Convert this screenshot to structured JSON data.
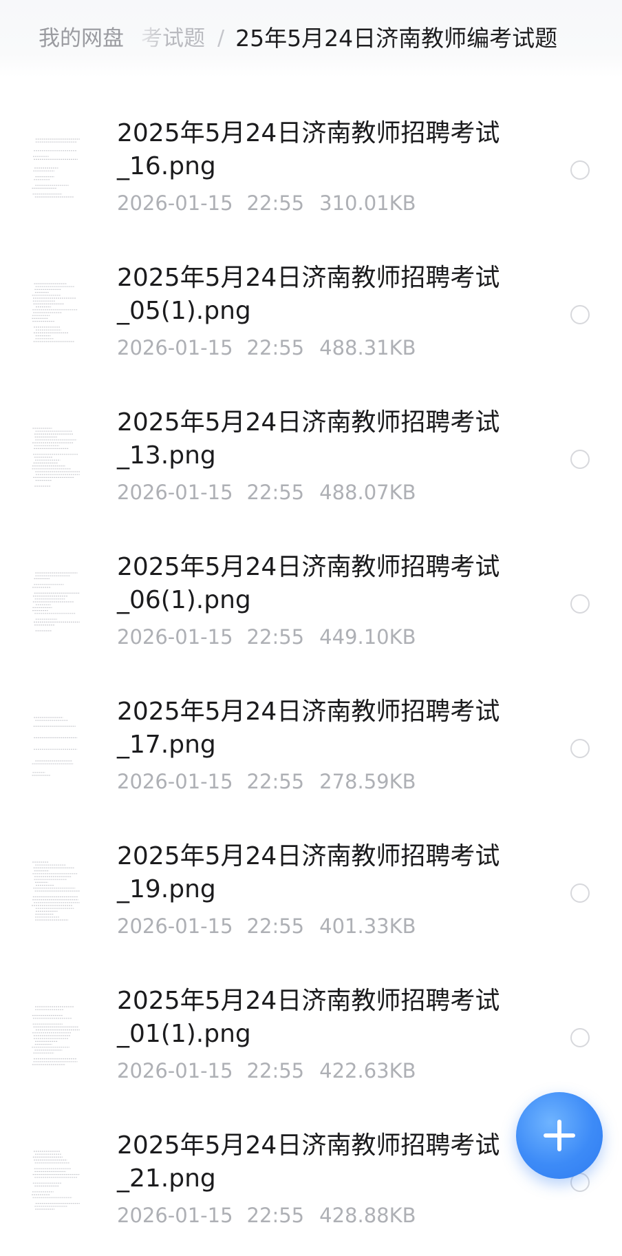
{
  "breadcrumb": {
    "root": "我的网盘",
    "parent": "考试题",
    "separator": "/",
    "current": "25年5月24日济南教师编考试题"
  },
  "files": [
    {
      "name": "2025年5月24日济南教师招聘考试_16.png",
      "date": "2026-01-15",
      "time": "22:55",
      "size": "310.01KB",
      "thumb_icon": "document-thumbnail-icon"
    },
    {
      "name": "2025年5月24日济南教师招聘考试_05(1).png",
      "date": "2026-01-15",
      "time": "22:55",
      "size": "488.31KB",
      "thumb_icon": "document-thumbnail-icon"
    },
    {
      "name": "2025年5月24日济南教师招聘考试_13.png",
      "date": "2026-01-15",
      "time": "22:55",
      "size": "488.07KB",
      "thumb_icon": "document-thumbnail-icon"
    },
    {
      "name": "2025年5月24日济南教师招聘考试_06(1).png",
      "date": "2026-01-15",
      "time": "22:55",
      "size": "449.10KB",
      "thumb_icon": "document-thumbnail-icon"
    },
    {
      "name": "2025年5月24日济南教师招聘考试_17.png",
      "date": "2026-01-15",
      "time": "22:55",
      "size": "278.59KB",
      "thumb_icon": "document-thumbnail-icon"
    },
    {
      "name": "2025年5月24日济南教师招聘考试_19.png",
      "date": "2026-01-15",
      "time": "22:55",
      "size": "401.33KB",
      "thumb_icon": "document-thumbnail-icon"
    },
    {
      "name": "2025年5月24日济南教师招聘考试_01(1).png",
      "date": "2026-01-15",
      "time": "22:55",
      "size": "422.63KB",
      "thumb_icon": "document-thumbnail-icon"
    },
    {
      "name": "2025年5月24日济南教师招聘考试_21.png",
      "date": "2026-01-15",
      "time": "22:55",
      "size": "428.88KB",
      "thumb_icon": "document-thumbnail-icon"
    }
  ],
  "fab": {
    "icon": "plus-icon",
    "color": "#3d8bf7"
  },
  "colors": {
    "text_primary": "#1b1b1d",
    "text_secondary": "#aeb0b5",
    "select_circle": "#d7d8dc"
  }
}
